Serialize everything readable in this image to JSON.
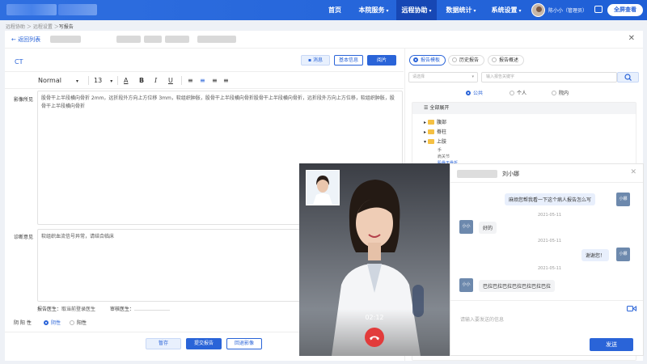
{
  "nav": {
    "items": [
      {
        "label": "首页"
      },
      {
        "label": "本院服务"
      },
      {
        "label": "远程协助"
      },
      {
        "label": "数据统计"
      },
      {
        "label": "系统设置"
      }
    ],
    "user": "陈小小（管理员）",
    "fullscreen": "全屏查看",
    "colors": {
      "primary": "#2a64d8",
      "nav_bg": "#2f6fe0",
      "nav_active": "#1747b4"
    }
  },
  "breadcrumb": {
    "prefix": "远程协助 ＞ 远程设置 ＞",
    "current": "写报告"
  },
  "header": {
    "back": "返回列表"
  },
  "report": {
    "modality": "CT",
    "btn_message": "消息",
    "btn_basic": "基本信息",
    "btn_film": "阅片",
    "font_style": "Normal",
    "font_size": "13",
    "findings_label": "影像所见",
    "findings_text": "股骨干上半段横向骨折 2mm，远折段外方向上方位移 3mm，软组织肿胀，股骨干上半段横向骨折股骨干上半段横向骨折，远折段外方向上方位移，软组织肿胀，股骨干上半段横向骨折",
    "impression_label": "诊断意见",
    "impression_text": "软组织血流信号异常，请结合临床",
    "doctor_label": "报告医生：",
    "doctor_value": "取当前登录医生",
    "reviewer_label": "审核医生：",
    "result_label": "阴 阳 性",
    "positive": "阴性",
    "negative": "阳性",
    "btn_save": "暂存",
    "btn_submit": "提交报告",
    "btn_return": "回退影像"
  },
  "templates": {
    "tabs": [
      {
        "label": "报告模板"
      },
      {
        "label": "历史报告"
      },
      {
        "label": "报告概述"
      }
    ],
    "select_placeholder": "请选择",
    "search_placeholder": "输入报告关键字",
    "scopes": [
      {
        "label": "公共"
      },
      {
        "label": "个人"
      },
      {
        "label": "院内"
      }
    ],
    "expand_all": "全部展开",
    "tree": [
      {
        "label": "腹部"
      },
      {
        "label": "脊柱"
      },
      {
        "label": "上肢"
      }
    ],
    "leaves": [
      {
        "label": "手"
      },
      {
        "label": "肩关节"
      },
      {
        "label": "股骨干骨折"
      }
    ]
  },
  "video": {
    "timer": "02:12"
  },
  "chat": {
    "title": "刘小娜",
    "messages": [
      {
        "from": "me",
        "text": "麻烦您帮我看一下这个病人报告怎么写",
        "avatar": "小娜"
      },
      {
        "time": "2021-05-11"
      },
      {
        "from": "them",
        "text": "好的",
        "avatar": "小小"
      },
      {
        "time": "2021-05-11"
      },
      {
        "from": "me",
        "text": "谢谢您！",
        "avatar": "小娜"
      },
      {
        "time": "2021-05-11"
      },
      {
        "from": "them",
        "text": "巴拉巴拉巴拉巴拉巴拉巴拉巴拉",
        "avatar": "小小"
      }
    ],
    "input_placeholder": "请输入要发送的信息",
    "send": "发送"
  }
}
